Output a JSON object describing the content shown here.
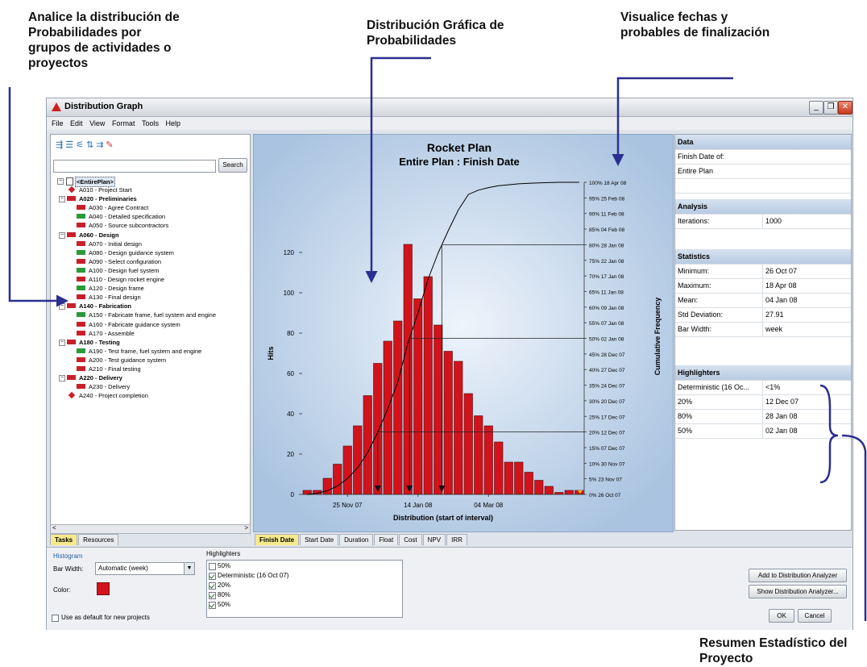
{
  "annotations": {
    "left": [
      "Analice la distribución de",
      "Probabilidades por",
      "grupos de actividades o",
      "proyectos"
    ],
    "center": [
      "Distribución Gráfica de",
      "Probabilidades"
    ],
    "right": [
      "Visualice fechas y",
      "probables de finalización"
    ],
    "bottom": [
      "Resumen Estadístico del",
      "Proyecto"
    ]
  },
  "window": {
    "title": "Distribution Graph",
    "menu": [
      "File",
      "Edit",
      "View",
      "Format",
      "Tools",
      "Help"
    ],
    "restore_glyph": "❐",
    "close_glyph": "✕"
  },
  "left_panel": {
    "toolbar_icons": [
      "outline-icon",
      "expand-icon",
      "filter-icon",
      "sort-icon",
      "group-icon",
      "highlight-icon"
    ],
    "search_button": "Search",
    "tree": [
      {
        "label": "<EntirePlan>",
        "indent": 0,
        "kind": "root",
        "bold": true
      },
      {
        "label": "A010 - Project Start",
        "indent": 1,
        "kind": "milestone"
      },
      {
        "label": "A020 - Preliminaries",
        "indent": 1,
        "kind": "summary",
        "bold": true
      },
      {
        "label": "A030 - Agree Contract",
        "indent": 2,
        "kind": "red"
      },
      {
        "label": "A040 - Detailed specification",
        "indent": 2,
        "kind": "green"
      },
      {
        "label": "A050 - Source subcontractors",
        "indent": 2,
        "kind": "red"
      },
      {
        "label": "A060 - Design",
        "indent": 1,
        "kind": "summary",
        "bold": true
      },
      {
        "label": "A070 - Initial design",
        "indent": 2,
        "kind": "red"
      },
      {
        "label": "A080 - Design guidance system",
        "indent": 2,
        "kind": "green"
      },
      {
        "label": "A090 - Select configuration",
        "indent": 2,
        "kind": "red"
      },
      {
        "label": "A100 - Design fuel system",
        "indent": 2,
        "kind": "green"
      },
      {
        "label": "A110 - Design rocket engine",
        "indent": 2,
        "kind": "red"
      },
      {
        "label": "A120 - Design frame",
        "indent": 2,
        "kind": "green"
      },
      {
        "label": "A130 - Final design",
        "indent": 2,
        "kind": "red"
      },
      {
        "label": "A140 - Fabrication",
        "indent": 1,
        "kind": "summary",
        "bold": true
      },
      {
        "label": "A150 - Fabricate frame, fuel system and engine",
        "indent": 2,
        "kind": "green"
      },
      {
        "label": "A160 - Fabricate guidance system",
        "indent": 2,
        "kind": "red"
      },
      {
        "label": "A170 - Assemble",
        "indent": 2,
        "kind": "red"
      },
      {
        "label": "A180 - Testing",
        "indent": 1,
        "kind": "summary",
        "bold": true
      },
      {
        "label": "A190 - Test frame, fuel system and engine",
        "indent": 2,
        "kind": "green"
      },
      {
        "label": "A200 - Test guidance system",
        "indent": 2,
        "kind": "red"
      },
      {
        "label": "A210 - Final testing",
        "indent": 2,
        "kind": "red"
      },
      {
        "label": "A220 - Delivery",
        "indent": 1,
        "kind": "summary",
        "bold": true
      },
      {
        "label": "A230 - Delivery",
        "indent": 2,
        "kind": "red"
      },
      {
        "label": "A240 - Project completion",
        "indent": 1,
        "kind": "milestone"
      }
    ],
    "tabs": [
      "Tasks",
      "Resources"
    ],
    "scroll_left": "<",
    "scroll_right": ">"
  },
  "chart_tabs": [
    "Finish Date",
    "Start Date",
    "Duration",
    "Float",
    "Cost",
    "NPV",
    "IRR"
  ],
  "chart_data": {
    "type": "bar",
    "title": "Rocket Plan",
    "subtitle": "Entire Plan : Finish Date",
    "xlabel": "Distribution (start of interval)",
    "ylabel": "Hits",
    "y2label": "Cumulative Frequency",
    "ylim": [
      0,
      140
    ],
    "yticks": [
      0,
      20,
      40,
      60,
      80,
      100,
      120
    ],
    "values": [
      2,
      2,
      8,
      15,
      24,
      34,
      49,
      65,
      76,
      86,
      124,
      97,
      108,
      84,
      71,
      66,
      50,
      39,
      34,
      26,
      16,
      16,
      11,
      7,
      4,
      1,
      2,
      2
    ],
    "x_ticks": [
      {
        "label": "25 Nov 07",
        "index": 4.5
      },
      {
        "label": "14 Jan 08",
        "index": 11.5
      },
      {
        "label": "04 Mar 08",
        "index": 18.5
      }
    ],
    "cumulative_labels": [
      "0%  26 Oct 07",
      "5%  23 Nov 07",
      "10%  30 Nov 07",
      "15%  07 Dec 07",
      "20%  12 Dec 07",
      "25%  17 Dec 07",
      "30%  20 Dec 07",
      "35%  24 Dec 07",
      "40%  27 Dec 07",
      "45%  28 Dec 07",
      "50%  02 Jan 08",
      "55%  07 Jan 08",
      "60%  09 Jan 08",
      "65%  11 Jan 08",
      "70%  17 Jan 08",
      "75%  22 Jan 08",
      "80%  28 Jan 08",
      "85%  04 Feb 08",
      "90%  11 Feb 08",
      "95%  25 Feb 08",
      "100%  18 Apr 08"
    ],
    "cumulative": [
      0,
      0.4,
      1.2,
      2.7,
      5.1,
      8.5,
      13.4,
      19.9,
      27.5,
      36.1,
      48.5,
      58.2,
      69,
      77.4,
      84.5,
      91.1,
      96.1,
      97.5,
      98.3,
      98.9,
      99.2,
      99.5,
      99.7,
      99.8,
      99.9,
      100,
      100,
      100
    ],
    "highlighter_percents": [
      20,
      50,
      80
    ],
    "colors": {
      "bar": "#d2131c",
      "bar_edge": "#4a0a0a",
      "bg_outer": "#a9c3e0",
      "bg_inner": "#eef4fb",
      "curve": "#000000"
    }
  },
  "right_panel": {
    "data_header": "Data",
    "finish_date_of": "Finish Date of:",
    "entire_plan": "Entire Plan",
    "analysis_header": "Analysis",
    "iterations": {
      "label": "Iterations:",
      "value": "1000"
    },
    "statistics_header": "Statistics",
    "stats": [
      {
        "label": "Minimum:",
        "value": "26 Oct 07"
      },
      {
        "label": "Maximum:",
        "value": "18 Apr 08"
      },
      {
        "label": "Mean:",
        "value": "04 Jan 08"
      },
      {
        "label": "Std Deviation:",
        "value": "27.91"
      },
      {
        "label": "Bar Width:",
        "value": "week"
      }
    ],
    "highlighters_header": "Highlighters",
    "highlighters": [
      {
        "label": "Deterministic (16 Oc...",
        "value": "<1%"
      },
      {
        "label": "20%",
        "value": "12 Dec 07"
      },
      {
        "label": "80%",
        "value": "28 Jan 08"
      },
      {
        "label": "50%",
        "value": "02 Jan 08"
      }
    ]
  },
  "bottom_panel": {
    "histogram_label": "Histogram",
    "bar_width_label": "Bar Width:",
    "bar_width_value": "Automatic (week)",
    "color_label": "Color:",
    "default_label": "Use as default for new projects",
    "highlighters_label": "Highlighters",
    "highlighter_items": [
      {
        "label": "50%",
        "checked": false
      },
      {
        "label": "Deterministic (16 Oct 07)",
        "checked": true
      },
      {
        "label": "20%",
        "checked": true
      },
      {
        "label": "80%",
        "checked": true
      },
      {
        "label": "50%",
        "checked": true
      }
    ],
    "add_button": "Add to Distribution Analyzer",
    "show_button": "Show Distribution Analyzer...",
    "ok_button": "OK",
    "cancel_button": "Cancel"
  }
}
